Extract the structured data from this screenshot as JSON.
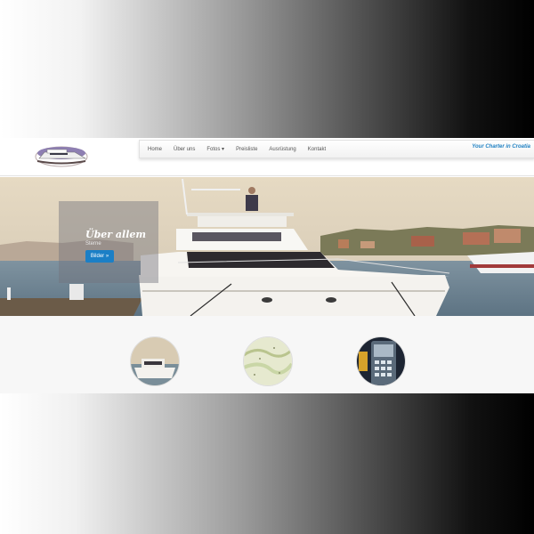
{
  "logo": {
    "alt": "yacht-logo"
  },
  "nav": {
    "items": [
      "Home",
      "Über uns",
      "Fotos ▾",
      "Preisliste",
      "Ausrüstung",
      "Kontakt"
    ]
  },
  "tagline": "Your Charter in Croatia",
  "hero": {
    "title": "Über allem",
    "subtitle": "Sterne",
    "button_label": "Bilder »"
  },
  "thumbnails": [
    {
      "subject": "yacht"
    },
    {
      "subject": "nautical-chart"
    },
    {
      "subject": "navigation-device"
    }
  ],
  "colors": {
    "accent": "#1b7fc6",
    "tagline": "#1c7fc2",
    "nav_text": "#555555"
  }
}
